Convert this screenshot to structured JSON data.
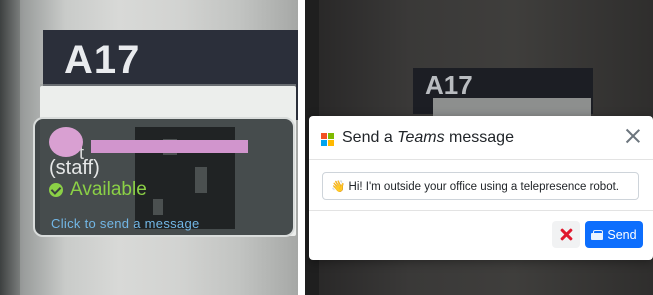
{
  "left_view": {
    "room_number": "A17",
    "name_fragment": "t",
    "role": "(staff)",
    "status": "Available",
    "action_hint": "Click to send a message"
  },
  "right_view": {
    "room_number": "A17"
  },
  "teams_dialog": {
    "title_prefix": "Send a ",
    "title_app": "Teams",
    "title_suffix": " message",
    "message_value": "👋 Hi! I'm outside your office using a telepresence robot.",
    "cancel_icon": "close-x-icon",
    "send_label": "Send",
    "send_icon": "send-icon"
  },
  "colors": {
    "available_green": "#8bd046",
    "link_blue": "#72b7e6",
    "send_button_blue": "#0d6efd",
    "cancel_red": "#e0182d",
    "redaction_pink": "#d195cd"
  }
}
